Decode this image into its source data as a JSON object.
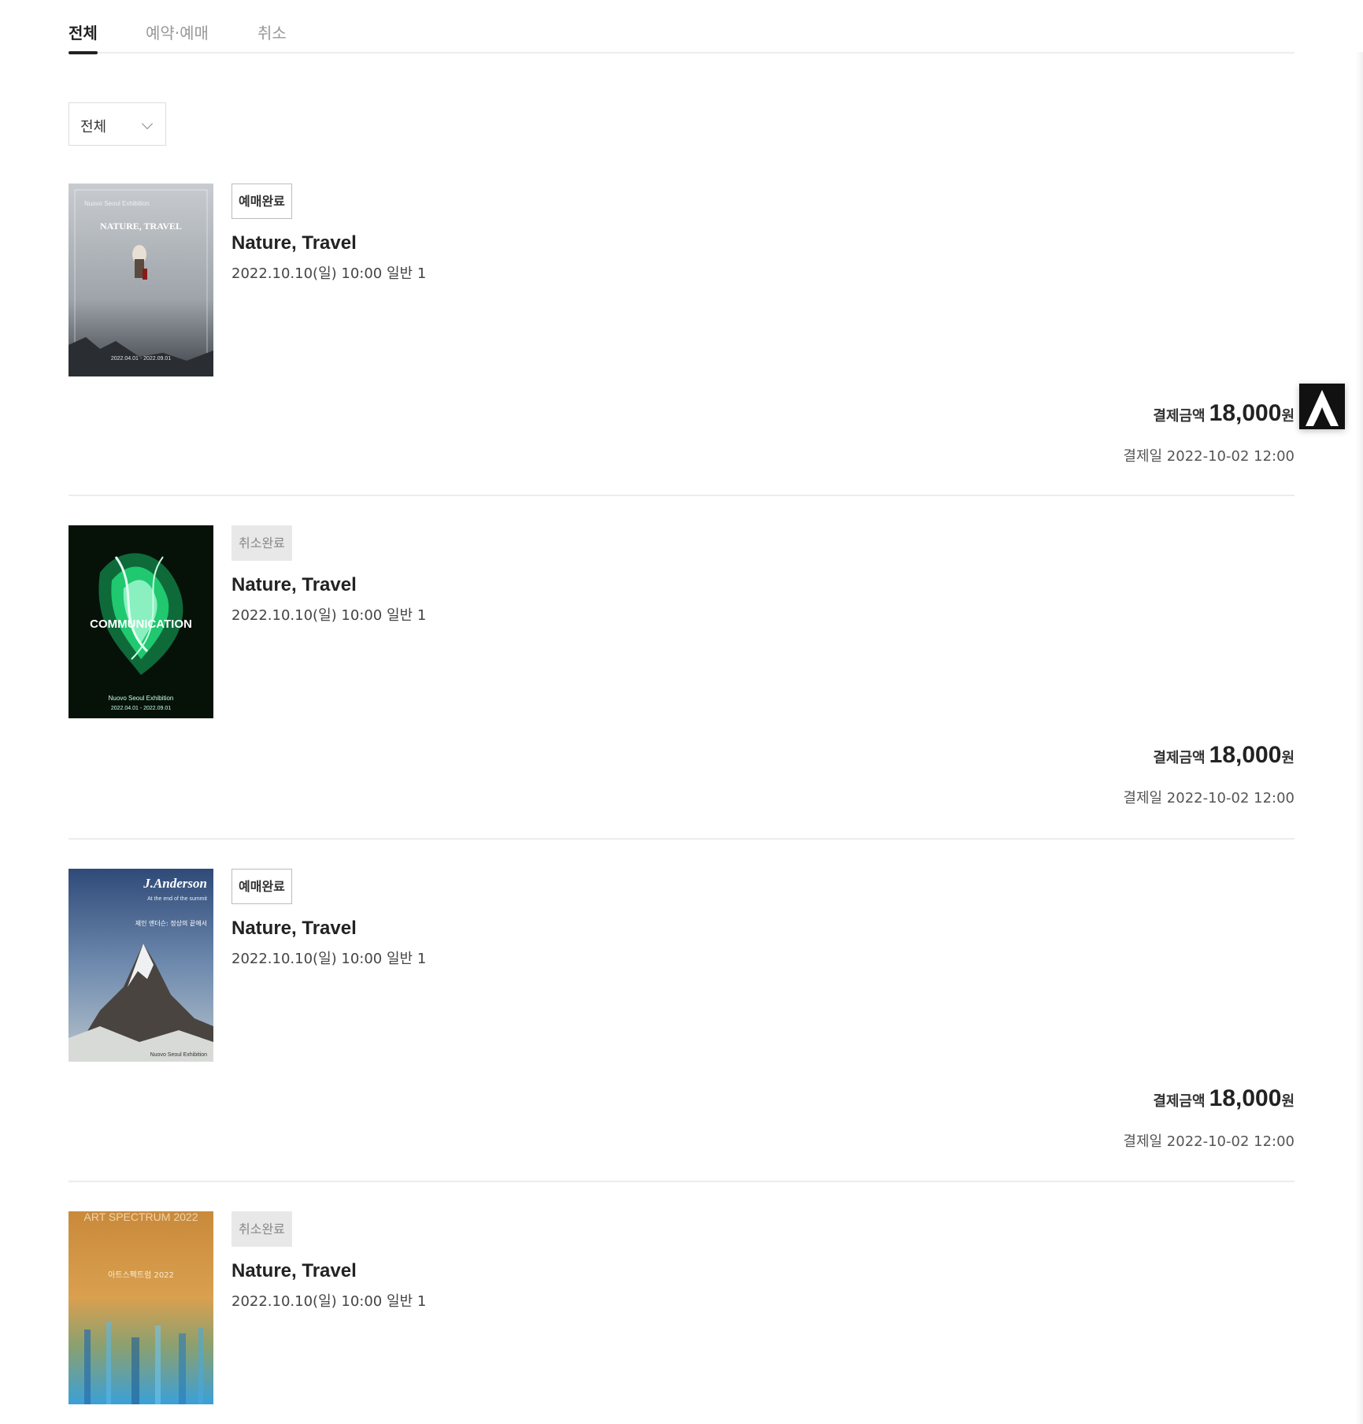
{
  "tabs": [
    {
      "label": "전체"
    },
    {
      "label": "예약·예매"
    },
    {
      "label": "취소"
    }
  ],
  "filter": {
    "selected": "전체"
  },
  "orders": [
    {
      "status": "예매완료",
      "title": "Nature, Travel",
      "date": "2022.10.10(일) 10:00 일반 1",
      "price_label": "결제금액",
      "price": "18,000",
      "price_unit": "원",
      "paydate": "결제일 2022-10-02 12:00",
      "poster": {
        "top_text": "Nuovo Seoul Exhibition",
        "headline": "NATURE, TRAVEL",
        "bottom_text": "2022.04.01 - 2022.09.01"
      }
    },
    {
      "status": "취소완료",
      "title": "Nature, Travel",
      "date": "2022.10.10(일) 10:00 일반 1",
      "price_label": "결제금액",
      "price": "18,000",
      "price_unit": "원",
      "paydate": "결제일 2022-10-02 12:00",
      "poster": {
        "headline": "COMMUNICATION",
        "bottom_text": "Nuovo Seoul Exhibition",
        "bottom_date": "2022.04.01 - 2022.09.01"
      }
    },
    {
      "status": "예매완료",
      "title": "Nature, Travel",
      "date": "2022.10.10(일) 10:00 일반 1",
      "price_label": "결제금액",
      "price": "18,000",
      "price_unit": "원",
      "paydate": "결제일 2022-10-02 12:00",
      "poster": {
        "headline": "J.Anderson",
        "sub": "At the end of the summit",
        "korean": "제인 앤더슨: 정상의 끝에서",
        "bottom_text": "Nuovo Seoul Exhibition"
      }
    },
    {
      "status": "취소완료",
      "title": "Nature, Travel",
      "date": "2022.10.10(일) 10:00 일반 1",
      "poster": {
        "headline": "ART SPECTRUM 2022",
        "korean": "아트스펙트럼 2022"
      }
    }
  ],
  "top_button": {
    "icon": "arrow-up-icon"
  },
  "colors": {
    "accent": "#222222",
    "badge_cancel_bg": "#e8e8e8",
    "divider": "#ececec"
  }
}
